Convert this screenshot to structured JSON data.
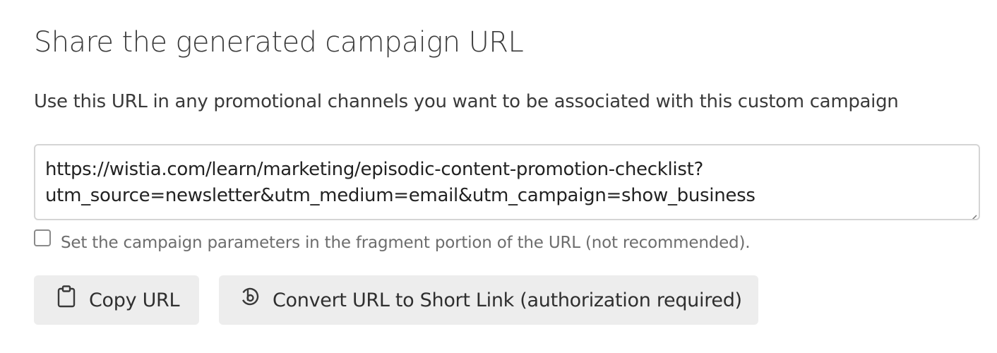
{
  "header": {
    "title": "Share the generated campaign URL",
    "description": "Use this URL in any promotional channels you want to be associated with this custom campaign"
  },
  "url_field": {
    "line1": "https://wistia.com/learn/marketing/episodic-content-promotion-checklist?",
    "line2": "utm_source=newsletter&utm_medium=email&utm_campaign=show_business"
  },
  "fragment_option": {
    "checked": false,
    "label": "Set the campaign parameters in the fragment portion of the URL (not recommended)."
  },
  "actions": {
    "copy_label": "Copy URL",
    "copy_icon": "clipboard-icon",
    "shorten_label": "Convert URL to Short Link (authorization required)",
    "shorten_icon": "bitly-icon"
  },
  "colors": {
    "button_background": "#ededed",
    "field_border": "#d5d5d5",
    "muted_text": "#6d6d6d"
  }
}
